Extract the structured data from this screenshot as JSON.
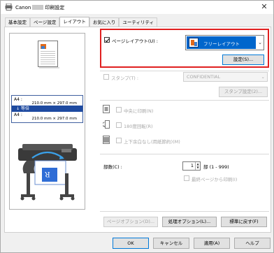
{
  "window": {
    "title_prefix": "Canon",
    "title_suffix": "印刷設定",
    "close_glyph": "✕"
  },
  "tabs": [
    {
      "label": "基本設定"
    },
    {
      "label": "ページ設定"
    },
    {
      "label": "レイアウト",
      "active": true
    },
    {
      "label": "お気に入り"
    },
    {
      "label": "ユーティリティ"
    }
  ],
  "preview": {
    "sizes": [
      {
        "label": "A4 :",
        "dims": "210.0 mm × 297.0 mm"
      },
      {
        "label": "A4 :",
        "dims": "210.0 mm × 297.0 mm"
      }
    ],
    "scale_label": "↓ 等倍",
    "printer_paper_letter": "R"
  },
  "page_layout": {
    "checkbox_label": "ページレイアウト(U) :",
    "checked": true,
    "selected": "フリーレイアウト",
    "settings_button": "設定(S)..."
  },
  "stamp": {
    "checkbox_label": "スタンプ(T) :",
    "checked": false,
    "selected": "CONFIDENTIAL",
    "settings_button": "スタンプ設定(2)..."
  },
  "options": [
    {
      "label": "中央に印刷(N)",
      "icon": "center-print-icon"
    },
    {
      "label": "180度回転(R)",
      "icon": "rotate-180-icon"
    },
    {
      "label": "上下余白なし(用紙節約)(M)",
      "icon": "no-margin-icon"
    }
  ],
  "copies": {
    "label": "部数(C) :",
    "value": "1",
    "range": "部 (1 - 999)",
    "last_page_label": "最終ページから印刷(I)"
  },
  "panel_buttons": {
    "page_options": "ページオプション(D)...",
    "processing_options": "処理オプション(L)...",
    "restore_defaults": "標準に戻す(F)"
  },
  "dialog_buttons": {
    "ok": "OK",
    "cancel": "キャンセル",
    "apply": "適用(A)",
    "help": "ヘルプ"
  },
  "colors": {
    "highlight_border": "#e02020",
    "selection_blue": "#0066cc",
    "size_band": "#1e4aa0"
  }
}
